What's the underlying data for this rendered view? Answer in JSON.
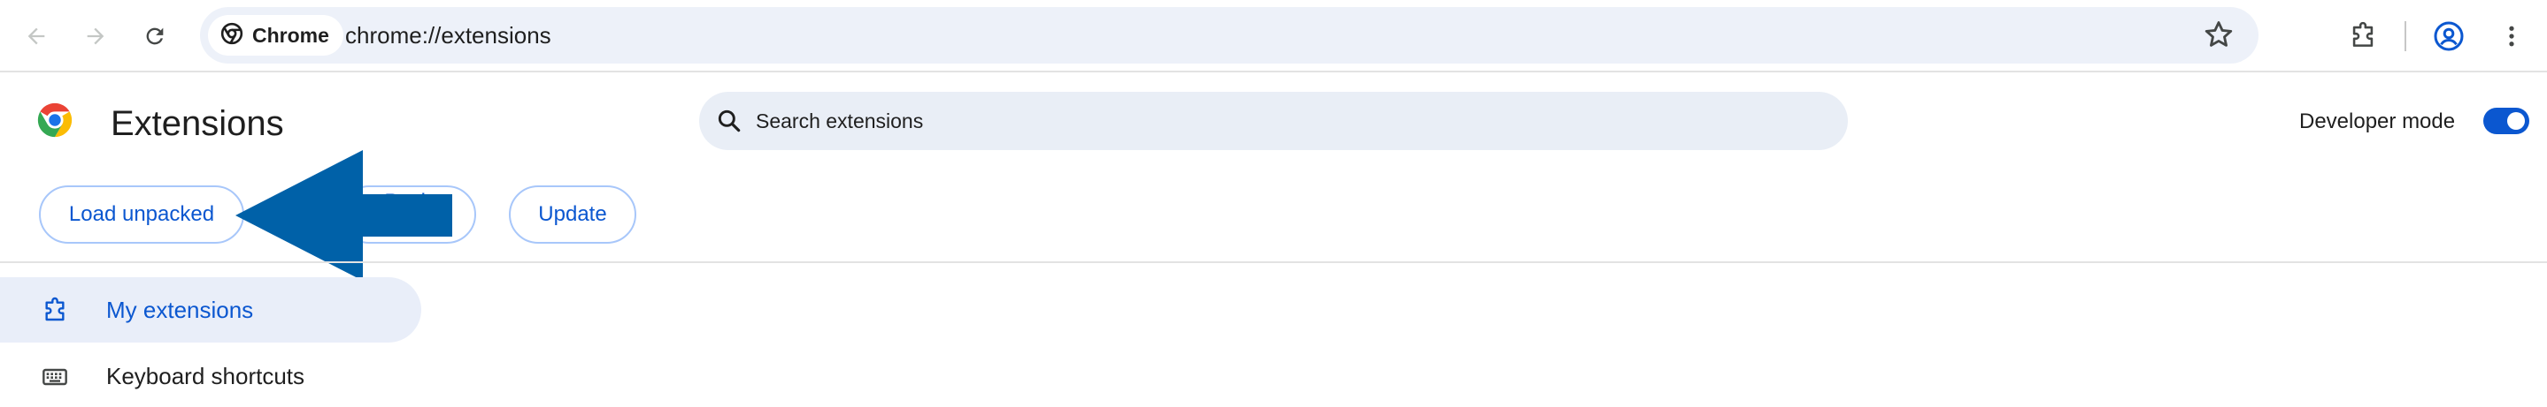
{
  "browser": {
    "chip_label": "Chrome",
    "url": "chrome://extensions",
    "icons": [
      "back-arrow-icon",
      "forward-arrow-icon",
      "reload-icon",
      "bookmark-star-icon",
      "extensions-puzzle-icon",
      "profile-icon",
      "menu-kebab-icon"
    ]
  },
  "header": {
    "title": "Extensions",
    "search_placeholder": "Search extensions",
    "developer_mode_label": "Developer mode",
    "developer_mode_on": true
  },
  "actions": {
    "load_unpacked": "Load unpacked",
    "pack_extension": "Pack extension",
    "update": "Update"
  },
  "sidebar": {
    "items": [
      {
        "label": "My extensions",
        "active": true,
        "icon": "puzzle-icon"
      },
      {
        "label": "Keyboard shortcuts",
        "active": false,
        "icon": "keyboard-icon"
      }
    ]
  },
  "colors": {
    "accent": "#0b57d0",
    "annotation_arrow": "#0061a8",
    "omnibox_bg": "#edf1f9"
  }
}
